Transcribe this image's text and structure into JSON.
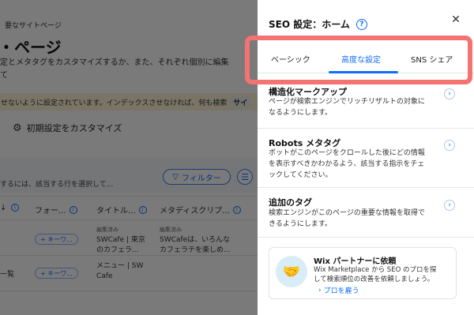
{
  "background": {
    "breadcrumb": "要なサイトページ",
    "page_title": "・ページ",
    "description_line1": "定とメタタグをカスタマイズするか、また、それぞれ個別に編集",
    "description_line2": "て",
    "notice_text": "せないように設定されています。インデックスさせなければ、何も検索",
    "notice_badge": "サイ",
    "customize_label": "初期設定をカスタマイズ",
    "toolbar_hint": "するには、該当する行を選択して...",
    "filter_label": "フィルター",
    "columns": [
      "フォー...",
      "タイトル...",
      "メタディスクリプ..."
    ],
    "rows": [
      {
        "keyword": "+ キーワ...",
        "title_edited": "編集済み",
        "title": "SWCafe | 東京",
        "title_line2": "のカフェラ...",
        "desc_edited": "編集済み",
        "desc": "SWCafeは、いろんな",
        "desc_line2": "カフェラテを楽しめ..."
      },
      {
        "label": "一覧",
        "keyword": "+ キーワ...",
        "title": "メニュー | SW",
        "title_line2": "Cafe"
      }
    ]
  },
  "panel": {
    "title": "SEO 設定：ホーム",
    "tabs": [
      {
        "label": "ベーシック"
      },
      {
        "label": "高度な設定"
      },
      {
        "label": "SNS シェア"
      }
    ],
    "sections": [
      {
        "title": "構造化マークアップ",
        "desc_line1": "ページが検索エンジンでリッチリザルトの対象に",
        "desc_line2": "なるようにします。"
      },
      {
        "title": "Robots メタタグ",
        "desc_line1": "ボットがこのページをクロールした後にどの情報",
        "desc_line2": "を表示すべきかわかるよう、該当する指示をチェ",
        "desc_line3": "ックしてください。"
      },
      {
        "title": "追加のタグ",
        "desc_line1": "検索エンジンがこのページの重要な情報を取得で",
        "desc_line2": "きるようにします。"
      }
    ],
    "partner": {
      "title": "Wix パートナーに依頼",
      "desc_line1": "Wix Marketplace から SEO のプロを探",
      "desc_line2": "して検索順位の改善を依頼しましょう。",
      "link": "プロを雇う"
    }
  },
  "colors": {
    "accent": "#116dff",
    "highlight": "#f47272",
    "notice_bg": "#fdf3d6"
  }
}
